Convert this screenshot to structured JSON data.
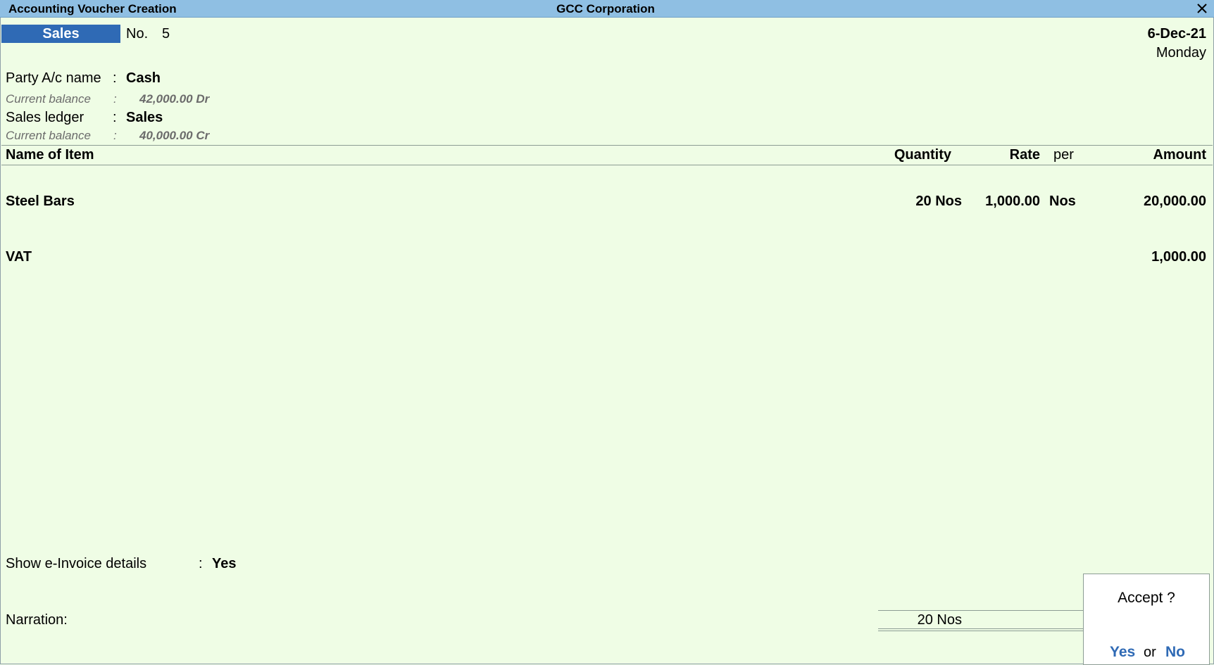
{
  "window": {
    "title": "Accounting Voucher Creation",
    "company": "GCC Corporation",
    "close_icon": "close-icon"
  },
  "voucher": {
    "type": "Sales",
    "no_label": "No.",
    "no_value": "5",
    "date": "6-Dec-21",
    "day": "Monday"
  },
  "party": {
    "label": "Party A/c name",
    "sep": ":",
    "value": "Cash",
    "balance_label": "Current balance",
    "balance_sep": ":",
    "balance_value": "42,000.00 Dr"
  },
  "sales_ledger": {
    "label": "Sales ledger",
    "sep": ":",
    "value": "Sales",
    "balance_label": "Current balance",
    "balance_sep": ":",
    "balance_value": "40,000.00 Cr"
  },
  "table": {
    "headers": {
      "name": "Name of Item",
      "quantity": "Quantity",
      "rate": "Rate",
      "per": "per",
      "amount": "Amount"
    },
    "rows": [
      {
        "name": "Steel Bars",
        "quantity": "20 Nos",
        "rate": "1,000.00",
        "per": "Nos",
        "amount": "20,000.00"
      },
      {
        "name": "VAT",
        "quantity": "",
        "rate": "",
        "per": "",
        "amount": "1,000.00"
      }
    ]
  },
  "footer": {
    "einvoice_label": "Show e-Invoice details",
    "einvoice_sep": ":",
    "einvoice_value": "Yes",
    "narration_label": "Narration:",
    "total_quantity": "20 Nos"
  },
  "accept_dialog": {
    "question": "Accept ?",
    "yes": "Yes",
    "or": "or",
    "no": "No"
  }
}
